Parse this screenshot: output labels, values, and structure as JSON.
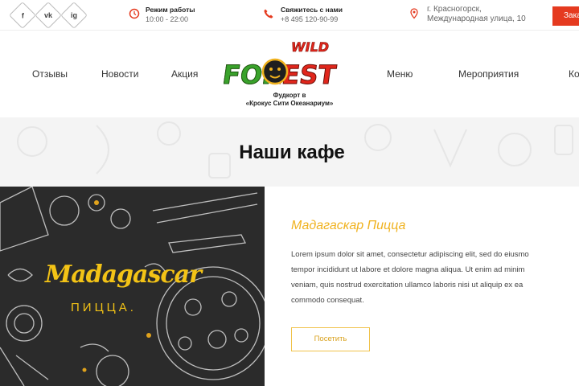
{
  "topbar": {
    "social": [
      "f",
      "vk",
      "ig"
    ],
    "hours_title": "Режим работы",
    "hours_value": "10:00 - 22:00",
    "contact_title": "Свяжитесь с нами",
    "contact_value": "+8 495 120-90-99",
    "address_line1": "г. Красногорск,",
    "address_line2": "Международная улица, 10",
    "order_label": "Зака"
  },
  "nav": {
    "items": [
      "Отзывы",
      "Новости",
      "Акция",
      "Меню",
      "Мероприятия",
      "Ко"
    ]
  },
  "logo": {
    "wild": "WILD",
    "forest": "FOREST",
    "caption_line1": "Фудкорт в",
    "caption_line2": "«Крокус Сити Океанариум»"
  },
  "section": {
    "title": "Наши кафе"
  },
  "cafe": {
    "brand_word": "Madagascar",
    "brand_sub": "ПИЦЦА.",
    "title": "Мадагаскар Пицца",
    "desc_lines": [
      "Lorem ipsum dolor sit amet, consectetur adipiscing elit, sed do eiusmo",
      "tempor incididunt ut labore et dolore magna aliqua. Ut enim ad minim",
      "veniam, quis nostrud exercitation ullamco laboris nisi ut aliquip ex ea",
      "commodo consequat."
    ],
    "visit_label": "Посетить"
  },
  "colors": {
    "accent": "#e53a1f",
    "gold": "#f0b21e",
    "logo_green": "#3aa22b",
    "logo_red": "#e1261c"
  }
}
